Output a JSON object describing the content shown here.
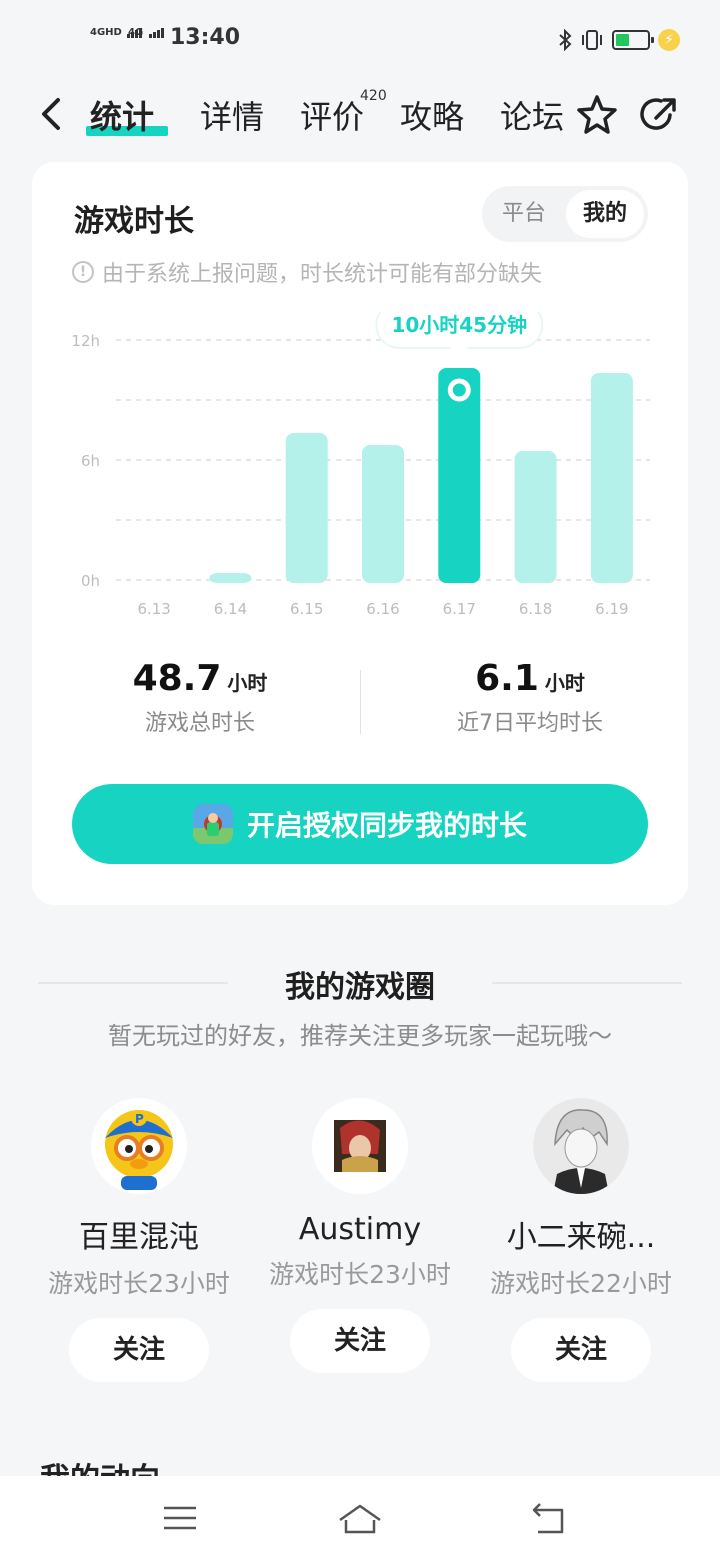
{
  "status_bar": {
    "network_1": "4GHD",
    "network_2": "4G",
    "time": "13:40",
    "battery_color": "#22c55e",
    "icons": [
      "bluetooth-icon",
      "vibrate-icon",
      "battery-icon",
      "charging-icon"
    ]
  },
  "nav": {
    "tabs": [
      {
        "label": "统计",
        "active": true
      },
      {
        "label": "详情"
      },
      {
        "label": "评价",
        "badge": "420"
      },
      {
        "label": "攻略"
      },
      {
        "label": "论坛"
      }
    ],
    "icons": [
      "back-arrow-icon",
      "star-icon",
      "share-icon"
    ]
  },
  "playtime_card": {
    "title": "游戏时长",
    "segments": {
      "platform": "平台",
      "mine": "我的"
    },
    "notice": "由于系统上报问题，时长统计可能有部分缺失",
    "summary": {
      "total_value": "48.7",
      "total_unit": "小时",
      "total_label": "游戏总时长",
      "avg_value": "6.1",
      "avg_unit": "小时",
      "avg_label": "近7日平均时长"
    },
    "cta_label": "开启授权同步我的时长"
  },
  "chart_data": {
    "type": "bar",
    "categories": [
      "6.13",
      "6.14",
      "6.15",
      "6.16",
      "6.17",
      "6.18",
      "6.19"
    ],
    "values": [
      0,
      0.4,
      7.5,
      6.9,
      10.75,
      6.6,
      10.5
    ],
    "y_ticks": [
      "0h",
      "6h",
      "12h"
    ],
    "ylim": [
      0,
      12
    ],
    "highlight_index": 4,
    "tooltip": "10小时45分钟",
    "bar_color": "#b3f1ea",
    "highlight_color": "#17d3c2",
    "grid": true
  },
  "game_circle": {
    "title": "我的游戏圈",
    "subtitle": "暂无玩过的好友，推荐关注更多玩家一起玩哦～",
    "friends": [
      {
        "name": "百里混沌",
        "playtime": "游戏时长23小时",
        "follow": "关注"
      },
      {
        "name": "Austimy",
        "playtime": "游戏时长23小时",
        "follow": "关注"
      },
      {
        "name": "小二来碗...",
        "playtime": "游戏时长22小时",
        "follow": "关注"
      }
    ]
  },
  "dynamics": {
    "title": "我的动向"
  },
  "system_nav": {
    "icons": [
      "menu-icon",
      "home-icon",
      "back-icon"
    ]
  },
  "colors": {
    "accent": "#17d3c2",
    "accent_light": "#b3f1ea"
  }
}
